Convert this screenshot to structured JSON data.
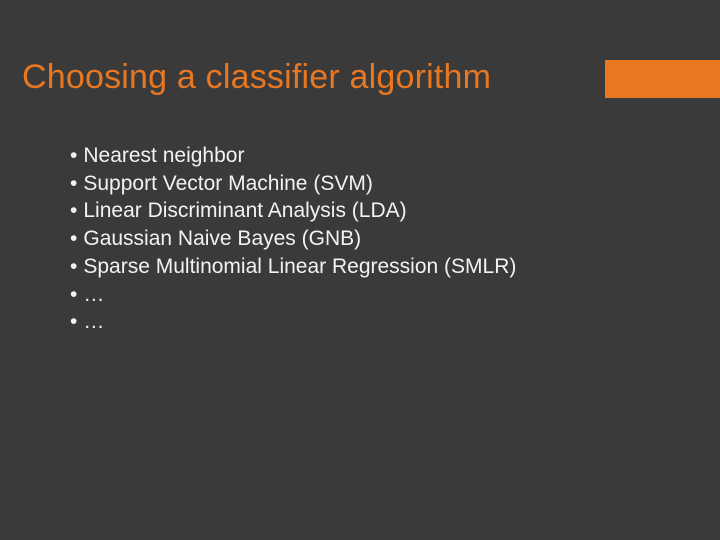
{
  "title": "Choosing a classifier algorithm",
  "bullets": [
    "Nearest neighbor",
    "Support Vector Machine (SVM)",
    "Linear Discriminant Analysis (LDA)",
    "Gaussian Naive Bayes (GNB)",
    "Sparse Multinomial Linear Regression (SMLR)",
    "…",
    "…"
  ],
  "glyphs": {
    "bullet": "•"
  }
}
